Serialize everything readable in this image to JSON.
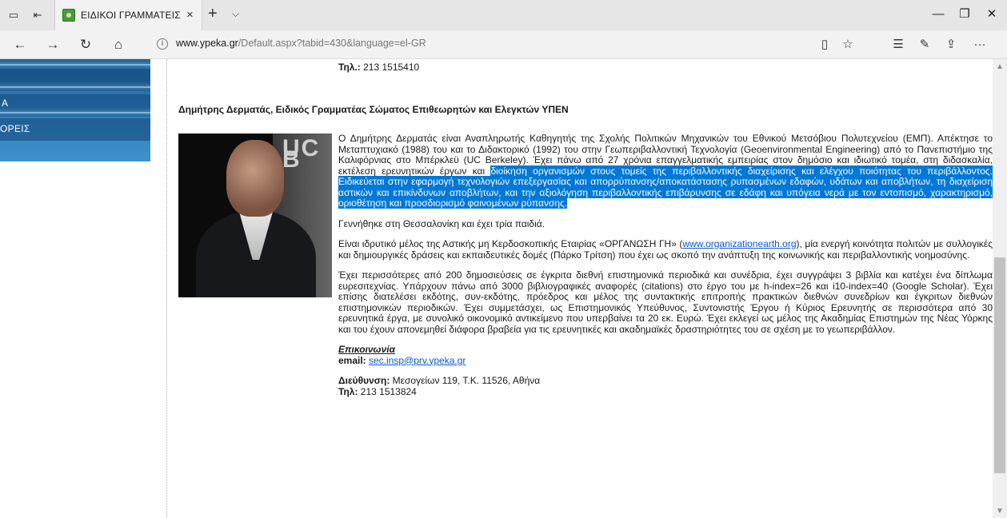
{
  "browser": {
    "tab_title": "ΕΙΔΙΚΟΙ ΓΡΑΜΜΑΤΕΙΣ",
    "tab_close": "×",
    "new_tab": "+",
    "tab_menu": "⌵",
    "url_host": "www.ypeka.gr",
    "url_path": "/Default.aspx?tabid=430&language=el-GR",
    "icons": [
      "tab-preview-icon",
      "set-aside-tabs-icon",
      "back-icon",
      "forward-icon",
      "refresh-icon",
      "home-icon",
      "site-info-icon",
      "reading-view-icon",
      "favorite-star-icon",
      "favorites-hub-icon",
      "web-note-icon",
      "share-icon",
      "more-icon",
      "minimize-icon",
      "maximize-icon",
      "close-icon"
    ],
    "glyphs": {
      "back": "←",
      "forward": "→",
      "refresh": "↻",
      "home": "⌂",
      "info": "i",
      "reading": "▯",
      "star": "☆",
      "hub": "☰",
      "note": "✎",
      "share": "⇪",
      "more": "···",
      "minimize": "—",
      "maximize": "❐",
      "close": "✕",
      "scroll_up": "▲",
      "scroll_down": "▼"
    }
  },
  "sidebar": {
    "partial_item_a": "Α",
    "partial_item_label": "ΟΡΕΙΣ"
  },
  "content": {
    "top_phone_label": "Τηλ.:",
    "top_phone_value": " 213 1515410",
    "heading": "Δημήτρης Δερματάς, Ειδικός Γραμματέας Σώματος Επιθεωρητών και Ελεγκτών ΥΠΕΝ",
    "photo_overlay_text": "UC B",
    "bio_p1_plain": "Ο Δημήτρης Δερματάς είναι Αναπληρωτής Καθηγητής της Σχολής Πολιτικών Μηχανικών του Εθνικού Μετσόβιου Πολυτεχνείου (ΕΜΠ). Απέκτησε το Μεταπτυχιακό (1988) του και το Διδακτορικό (1992) του στην Γεωπεριβαλλοντική Τεχνολογία (Geoenvironmental Engineering) από το Πανεπιστήμιο της Καλιφόρνιας στο Μπέρκλεϋ (UC Berkeley). Έχει πάνω από 27 χρόνια επαγγελματικής εμπειρίας στον δημόσιο και ιδιωτικό τομέα, στη διδασκαλία, εκτέλεση ερευνητικών έργων και ",
    "bio_p1_highlight": "διοίκηση οργανισμών στους τομείς της περιβαλλοντικής διαχείρισης και ελέγχου ποιότητας του περιβάλλοντος. Ειδικεύεται στην εφαρμογή τεχνολογιών επεξεργασίας και απορρύπανσης/αποκατάστασης ρυπασμένων εδαφών, υδάτων και αποβλήτων, τη διαχείριση αστικών και επικίνδυνων αποβλήτων, και την αξιολόγηση περιβαλλοντικής επιβάρυνσης σε εδάφη και υπόγεια νερά με τον εντοπισμό, χαρακτηρισμό, οριοθέτηση και προσδιορισμό φαινομένων ρύπανσης.",
    "bio_p2": "Γεννήθηκε στη Θεσσαλονίκη και έχει τρία παιδιά.",
    "bio_p3_before": "Είναι ιδρυτικό μέλος της Αστικής μη Κερδοσκοπικής Εταιρίας «ΟΡΓΑΝΩΣΗ ΓΗ» (",
    "bio_p3_link": "www.organizationearth.org",
    "bio_p3_after": "), μία ενεργή κοινότητα πολιτών με συλλογικές και δημιουργικές δράσεις και εκπαιδευτικές δομές (Πάρκο Τρίτση) που έχει ως σκοπό την ανάπτυξη της κοινωνικής και περιβαλλοντικής νοημοσύνης.",
    "bio_p4": "Έχει περισσότερες από 200 δημοσιεύσεις σε έγκριτα διεθνή επιστημονικά περιοδικά και συνέδρια, έχει συγγράψει 3 βιβλία και κατέχει ένα δίπλωμα ευρεσιτεχνίας. Υπάρχουν πάνω από 3000 βιβλιογραφικές αναφορές (citations) στο έργο του με h-index=26 και i10-index=40 (Google Scholar). Έχει επίσης διατελέσει εκδότης, συν-εκδότης, πρόεδρος και μέλος της συντακτικής επιτροπής πρακτικών διεθνών συνεδρίων και έγκριτων διεθνών επιστημονικών περιοδικών. Έχει συμμετάσχει, ως Επιστημονικός Υπεύθυνος, Συντονιστής Έργου ή Κύριος Ερευνητής σε περισσότερα από 30 ερευνητικά έργα, με συνολικό οικονομικό αντικείμενο που υπερβαίνει τα 20 εκ. Ευρώ. Έχει εκλεγεί ως μέλος της Ακαδημίας Επιστημών της Νέας Υόρκης και του έχουν απονεμηθεί διάφορα βραβεία για τις ερευνητικές και ακαδημαϊκές δραστηριότητες του σε σχέση με το γεωπεριβάλλον.",
    "contact_heading": "Επικοινωνία",
    "email_label": "email:",
    "email_value": "sec.insp@prv.ypeka.gr",
    "address_label": "Διεύθυνση:",
    "address_value": " Μεσογείων 119, Τ.Κ. 11526, Αθήνα",
    "phone_label": "Τηλ:",
    "phone_value": " 213 1513824"
  },
  "colors": {
    "selection": "#0078d7",
    "link": "#0b57d0",
    "sidebar": "#2a7cb7",
    "favicon": "#4a9a3c"
  }
}
